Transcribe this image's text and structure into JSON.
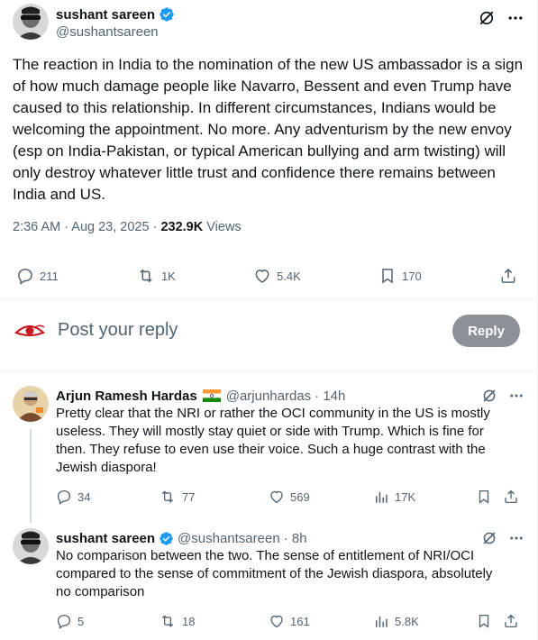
{
  "main_tweet": {
    "author_name": "sushant sareen",
    "author_handle": "@sushantsareen",
    "text": "The reaction in India to the nomination of the new US ambassador is a sign of how much damage people like Navarro, Bessent and even Trump have caused to this relationship. In different circumstances, Indians would be welcoming the appointment. No more. Any adventurism by the new envoy (esp on India-Pakistan, or typical American bullying and arm twisting) will only destroy whatever little trust and confidence there remains between India and US.",
    "time": "2:36 AM · Aug 23, 2025 · ",
    "views_count": "232.9K",
    "views_label": " Views",
    "replies": "211",
    "reposts": "1K",
    "likes": "5.4K",
    "bookmarks": "170"
  },
  "reply_composer": {
    "placeholder": "Post your reply",
    "button_label": "Reply"
  },
  "replies": [
    {
      "author_name": "Arjun Ramesh Hardas",
      "author_handle": "@arjunhardas",
      "time": "· 14h",
      "text": "Pretty clear that the NRI or rather the OCI community in the US is mostly useless. They will mostly stay quiet or side with Trump. Which is fine for then. They refuse to even use their voice. Such a huge contrast with the Jewish diaspora!",
      "replies": "34",
      "reposts": "77",
      "likes": "569",
      "views": "17K"
    },
    {
      "author_name": "sushant sareen",
      "author_handle": "@sushantsareen",
      "time": "· 8h",
      "text": "No comparison between the two. The sense of entitlement of NRI/OCI compared to the sense of commitment of the Jewish diaspora, absolutely no comparison",
      "replies": "5",
      "reposts": "18",
      "likes": "161",
      "views": "5.8K"
    }
  ],
  "colors": {
    "text": "#0f1419",
    "muted": "#536471",
    "verified": "#1d9bf0",
    "reply_button": "#8b9197"
  }
}
